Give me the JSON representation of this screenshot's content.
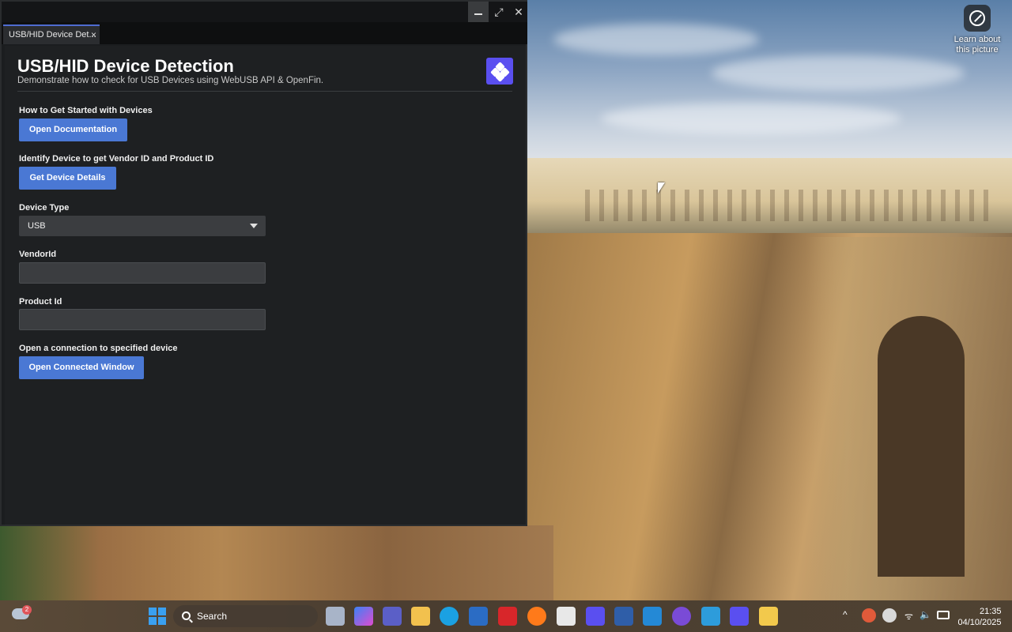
{
  "window": {
    "tab_label": "USB/HID Device Det...",
    "tab_close": "×",
    "controls": {
      "maximize": "⤢",
      "close": "✕"
    }
  },
  "header": {
    "title": "USB/HID Device Detection",
    "subtitle": "Demonstrate how to check for USB Devices using WebUSB API & OpenFin."
  },
  "sections": {
    "docs_label": "How to Get Started with Devices",
    "docs_button": "Open Documentation",
    "identify_label": "Identify Device to get Vendor ID and Product ID",
    "identify_button": "Get Device Details",
    "device_type_label": "Device Type",
    "device_type_value": "USB",
    "vendor_label": "VendorId",
    "vendor_value": "",
    "product_label": "Product Id",
    "product_value": "",
    "connect_label": "Open a connection to specified device",
    "connect_button": "Open Connected Window"
  },
  "desktop": {
    "learn_text": "Learn about this picture"
  },
  "taskbar": {
    "weather_badge": "2",
    "search_placeholder": "Search",
    "time": "21:35",
    "date": "04/10/2025",
    "tray": {
      "chevron": "^",
      "volume": "🔈",
      "wifi": "ᯤ"
    }
  },
  "colors": {
    "accent_button": "#4a78d4",
    "logo": "#5a4ff0",
    "background": "#1e2022"
  }
}
